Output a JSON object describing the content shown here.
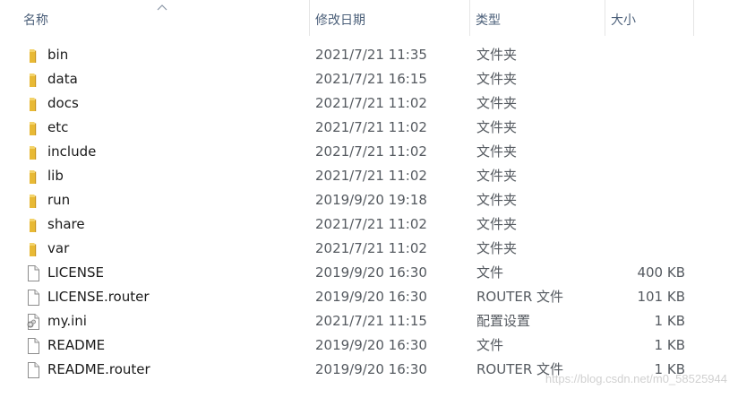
{
  "columns": {
    "name": "名称",
    "date": "修改日期",
    "type": "类型",
    "size": "大小"
  },
  "files": [
    {
      "icon": "folder-icon",
      "name": "bin",
      "date": "2021/7/21 11:35",
      "type": "文件夹",
      "size": ""
    },
    {
      "icon": "folder-icon",
      "name": "data",
      "date": "2021/7/21 16:15",
      "type": "文件夹",
      "size": ""
    },
    {
      "icon": "folder-icon",
      "name": "docs",
      "date": "2021/7/21 11:02",
      "type": "文件夹",
      "size": ""
    },
    {
      "icon": "folder-icon",
      "name": "etc",
      "date": "2021/7/21 11:02",
      "type": "文件夹",
      "size": ""
    },
    {
      "icon": "folder-icon",
      "name": "include",
      "date": "2021/7/21 11:02",
      "type": "文件夹",
      "size": ""
    },
    {
      "icon": "folder-icon",
      "name": "lib",
      "date": "2021/7/21 11:02",
      "type": "文件夹",
      "size": ""
    },
    {
      "icon": "folder-icon",
      "name": "run",
      "date": "2019/9/20 19:18",
      "type": "文件夹",
      "size": ""
    },
    {
      "icon": "folder-icon",
      "name": "share",
      "date": "2021/7/21 11:02",
      "type": "文件夹",
      "size": ""
    },
    {
      "icon": "folder-icon",
      "name": "var",
      "date": "2021/7/21 11:02",
      "type": "文件夹",
      "size": ""
    },
    {
      "icon": "file-icon",
      "name": "LICENSE",
      "date": "2019/9/20 16:30",
      "type": "文件",
      "size": "400 KB"
    },
    {
      "icon": "file-icon",
      "name": "LICENSE.router",
      "date": "2019/9/20 16:30",
      "type": "ROUTER 文件",
      "size": "101 KB"
    },
    {
      "icon": "settings-file-icon",
      "name": "my.ini",
      "date": "2021/7/21 11:15",
      "type": "配置设置",
      "size": "1 KB"
    },
    {
      "icon": "file-icon",
      "name": "README",
      "date": "2019/9/20 16:30",
      "type": "文件",
      "size": "1 KB"
    },
    {
      "icon": "file-icon",
      "name": "README.router",
      "date": "2019/9/20 16:30",
      "type": "ROUTER 文件",
      "size": "1 KB"
    }
  ],
  "watermark": "https://blog.csdn.net/m0_58525944",
  "colors": {
    "folder": "#e8b934",
    "header_text": "#4c607a",
    "separator": "#e5e5e5"
  }
}
